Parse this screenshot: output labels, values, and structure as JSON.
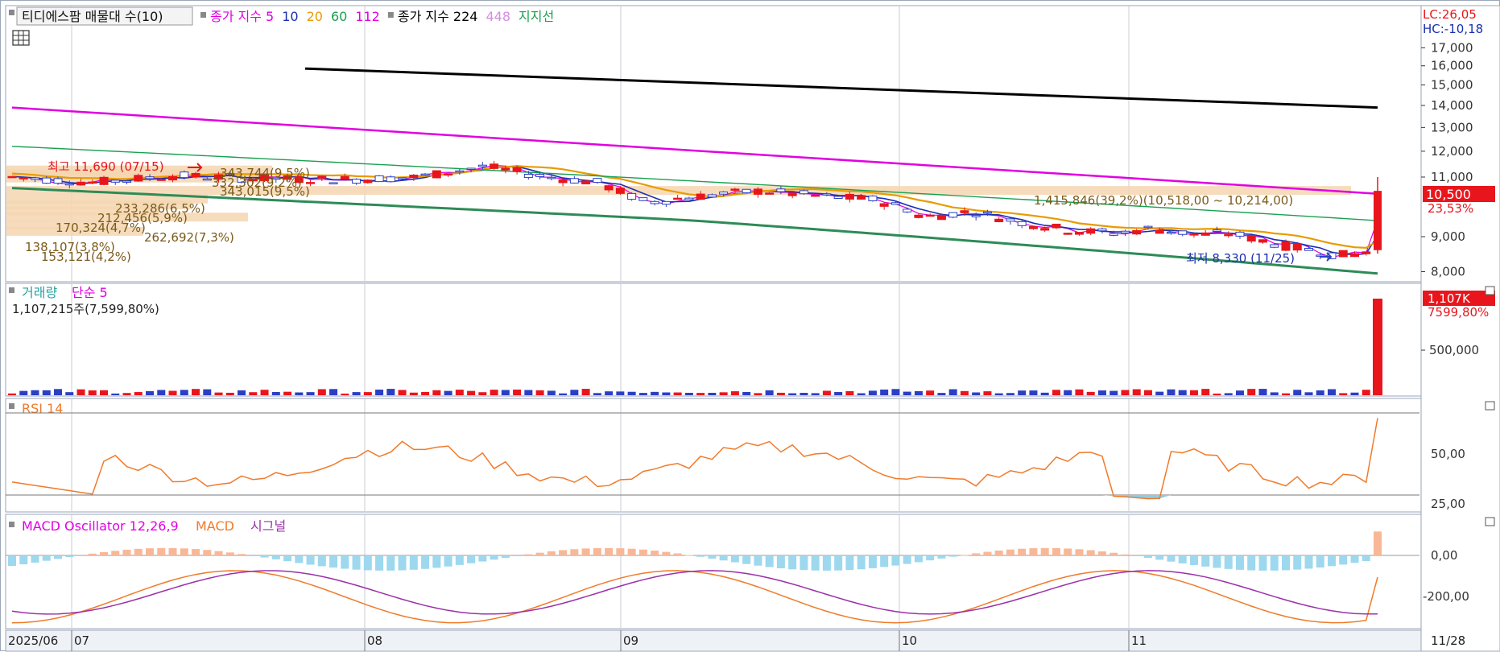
{
  "colors": {
    "candle_up": "#e8161c",
    "candle_down": "#2b3fc4",
    "ma5": "#e100e1",
    "ma10": "#1b2fb0",
    "ma20": "#e89b00",
    "ma60": "#1aa050",
    "ma112": "#e100e1",
    "ma224": "#000000",
    "support": "#2e8b57",
    "volume_profile": "#f5d6b0",
    "rsi": "#f07a2a",
    "rsi_fill": "#8ccde8",
    "macd": "#f07a2a",
    "signal": "#9b30a8",
    "osc_pos": "#f8b898",
    "osc_neg": "#9dd8ef",
    "grid": "#c9ced6",
    "axis_text": "#333333",
    "badge_red": "#e8161c"
  },
  "price_panel": {
    "legend_box": "티디에스팜 매물대 수(10)",
    "legend_items": [
      {
        "text": "종가 지수 5",
        "color": "#e100e1"
      },
      {
        "text": "10",
        "color": "#1b2fb0"
      },
      {
        "text": "20",
        "color": "#e89b00"
      },
      {
        "text": "60",
        "color": "#1aa050"
      },
      {
        "text": "112",
        "color": "#e100e1"
      },
      {
        "text": "종가 지수 224",
        "color": "#000000"
      },
      {
        "text": "448",
        "color": "#d48ee0"
      },
      {
        "text": "지지선",
        "color": "#1aa050"
      }
    ],
    "lc_label": "LC:26,05",
    "hc_label": "HC:-10,18",
    "y_ticks": [
      "17,000",
      "16,000",
      "15,000",
      "14,000",
      "13,000",
      "12,000",
      "11,000",
      "9,000",
      "8,000"
    ],
    "y_tick_values": [
      17000,
      16000,
      15000,
      14000,
      13000,
      12000,
      11000,
      9000,
      8000
    ],
    "current_price": "10,500",
    "current_change": "23,53%",
    "high_label": "최고 11,690 (07/15)",
    "low_label": "최저 8,330 (11/25)",
    "profile_labels": [
      "343,744(9,5%)",
      "332,302(9,2%)",
      "343,015(9,5%)",
      "233,286(6,5%)",
      "212,456(5,9%)",
      "170,324(4,7%)",
      "262,692(7,3%)",
      "138,107(3,8%)",
      "153,121(4,2%)"
    ],
    "profile_top_label": "1,415,846(39,2%)(10,518,00 ~ 10,214,00)"
  },
  "volume_panel": {
    "title": "거래량",
    "ma_label": "단순 5",
    "info": "1,107,215주(7,599,80%)",
    "badge": "1,107K",
    "badge_pct": "7599,80%",
    "tick": "500,000"
  },
  "rsi_panel": {
    "title": "RSI 14",
    "ticks": [
      "50,00",
      "25,00"
    ]
  },
  "macd_panel": {
    "title": "MACD Oscillator 12,26,9",
    "macd_label": "MACD",
    "signal_label": "시그널",
    "ticks": [
      "0,00",
      "-200,00"
    ]
  },
  "x_axis": {
    "labels": [
      "2025/06",
      "07",
      "08",
      "09",
      "10",
      "11"
    ],
    "end_label": "11/28"
  },
  "chart_data": {
    "type": "candlestick",
    "title": "티디에스팜 매물대 수(10)",
    "x_start": "2025/06",
    "x_end": "11/28",
    "ylim": [
      7800,
      17600
    ],
    "y_scale": "log",
    "high": 11690,
    "low": 8330,
    "last_close": 10500,
    "ma224": [
      15850,
      13900
    ],
    "ma112": [
      13900,
      10400
    ],
    "volume_last": 1107215,
    "rsi_last": 72,
    "rsi_lines": [
      70,
      30
    ]
  }
}
